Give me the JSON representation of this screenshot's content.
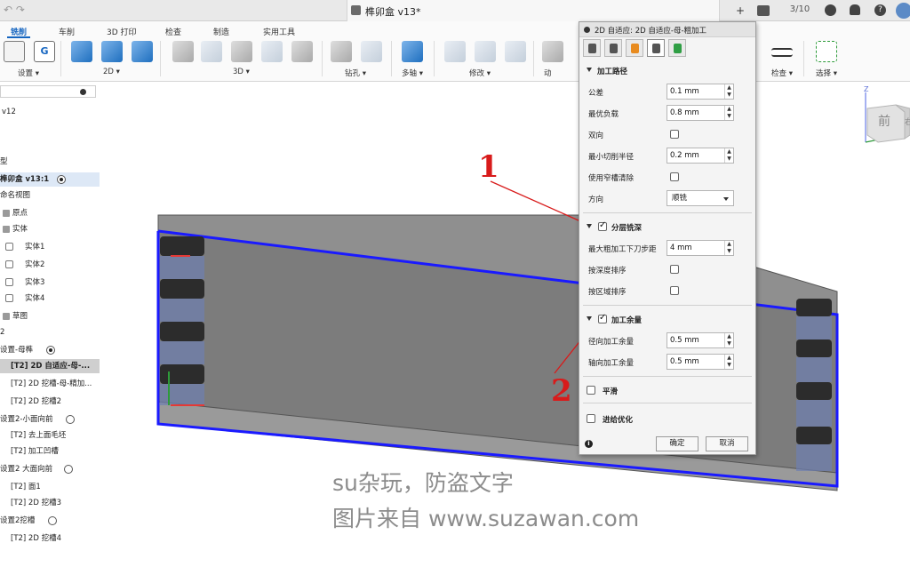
{
  "window": {
    "doc_title": "榫卯盒 v13*",
    "jobs_count": "3/10"
  },
  "ribbon": {
    "tabs": [
      {
        "label": "铣削",
        "active": true
      },
      {
        "label": "车削"
      },
      {
        "label": "3D 打印"
      },
      {
        "label": "检查"
      },
      {
        "label": "制造"
      },
      {
        "label": "实用工具"
      }
    ],
    "groups": {
      "setup": "设置 ▾",
      "2d": "2D ▾",
      "3d": "3D ▾",
      "drilling": "钻孔 ▾",
      "multiaxis": "多轴 ▾",
      "modify": "修改 ▾",
      "actions": "动",
      "inspect": "检查 ▾",
      "select": "选择 ▾"
    }
  },
  "browser": {
    "rows": [
      {
        "label": "v12"
      },
      {
        "label": ""
      },
      {
        "label": ""
      },
      {
        "label": "型"
      },
      {
        "label": "榫卯盒 v13:1",
        "selected": true
      },
      {
        "label": "命名视图"
      },
      {
        "label": "原点"
      },
      {
        "label": "实体"
      },
      {
        "label": "实体1"
      },
      {
        "label": "实体2"
      },
      {
        "label": "实体3"
      },
      {
        "label": "实体4"
      },
      {
        "label": "草图"
      },
      {
        "label": "2"
      },
      {
        "label": "设置-母榫"
      },
      {
        "label": "[T2] 2D 自适应-母-..."
      },
      {
        "label": "[T2] 2D 挖槽-母-精加..."
      },
      {
        "label": "[T2] 2D 挖槽2"
      },
      {
        "label": "设置2-小面向前"
      },
      {
        "label": "[T2] 去上面毛坯"
      },
      {
        "label": "[T2] 加工凹槽"
      },
      {
        "label": "设置2 大面向前"
      },
      {
        "label": "[T2] 面1"
      },
      {
        "label": "[T2] 2D 挖槽3"
      },
      {
        "label": "设置2挖槽"
      },
      {
        "label": "[T2] 2D 挖槽4"
      }
    ]
  },
  "viewcube": {
    "face_label": "前",
    "side_label": "右",
    "axis_z": "Z"
  },
  "panel": {
    "title": "2D 自适应: 2D 自适应-母-粗加工",
    "sections": {
      "passes": "加工路径",
      "multiple_depths": "分层铣深",
      "stock_to_leave": "加工余量",
      "smoothing": "平滑",
      "feed_optimization": "进给优化"
    },
    "fields": {
      "tolerance": {
        "label": "公差",
        "value": "0.1 mm"
      },
      "optimal_load": {
        "label": "最优负载",
        "value": "0.8 mm"
      },
      "both_ways": {
        "label": "双向"
      },
      "min_cut_radius": {
        "label": "最小切削半径",
        "value": "0.2 mm"
      },
      "use_slot_clearing": {
        "label": "使用窄槽清除"
      },
      "direction": {
        "label": "方向",
        "value": "顺铣"
      },
      "max_roughing_stepdown": {
        "label": "最大粗加工下刀步距",
        "value": "4 mm"
      },
      "order_by_depth": {
        "label": "按深度排序"
      },
      "order_by_area": {
        "label": "按区域排序"
      },
      "radial_stock": {
        "label": "径向加工余量",
        "value": "0.5 mm"
      },
      "axial_stock": {
        "label": "轴向加工余量",
        "value": "0.5 mm"
      }
    },
    "ok_label": "确定",
    "cancel_label": "取消"
  },
  "annotations": {
    "one": "1",
    "two": "2"
  },
  "watermark": {
    "line1": "su杂玩，防盗文字",
    "line2": "图片来自 www.suzawan.com"
  }
}
